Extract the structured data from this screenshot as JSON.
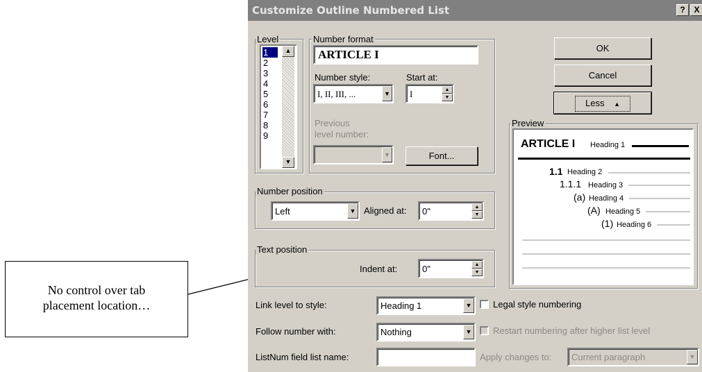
{
  "dialog": {
    "title": "Customize Outline Numbered List",
    "help_label": "?",
    "close_label": "X",
    "ok_label": "OK",
    "cancel_label": "Cancel",
    "less_label": "Less",
    "less_icon": "up-arrow-icon"
  },
  "level": {
    "label": "Level",
    "items": [
      "1",
      "2",
      "3",
      "4",
      "5",
      "6",
      "7",
      "8",
      "9"
    ],
    "selected": "1"
  },
  "number_format": {
    "label": "Number format",
    "value": "ARTICLE I",
    "number_style_label": "Number style:",
    "number_style_value": "I, II, III, ...",
    "start_at_label": "Start at:",
    "start_at_value": "I",
    "previous_label_1": "Previous",
    "previous_label_2": "level number:",
    "font_label": "Font..."
  },
  "number_position": {
    "label": "Number position",
    "value": "Left",
    "aligned_label": "Aligned at:",
    "aligned_value": "0\""
  },
  "text_position": {
    "label": "Text position",
    "indent_label": "Indent at:",
    "indent_value": "0\""
  },
  "preview": {
    "label": "Preview",
    "h1_num": "ARTICLE I",
    "h1_text": "Heading 1",
    "h2_num": "1.1",
    "h2_text": "Heading 2",
    "h3_num": "1.1.1",
    "h3_text": "Heading 3",
    "h4_num": "(a)",
    "h4_text": "Heading 4",
    "h5_num": "(A)",
    "h5_text": "Heading 5",
    "h6_num": "(1)",
    "h6_text": "Heading 6"
  },
  "bottom": {
    "link_label": "Link level to style:",
    "link_value": "Heading 1",
    "legal_label": "Legal style numbering",
    "follow_label": "Follow number with:",
    "follow_value": "Nothing",
    "restart_label": "Restart numbering after higher list level",
    "listnum_label": "ListNum field list name:",
    "apply_label": "Apply changes to:",
    "apply_value": "Current paragraph"
  },
  "callout": {
    "line1": "No control over tab",
    "line2": "placement location…"
  }
}
